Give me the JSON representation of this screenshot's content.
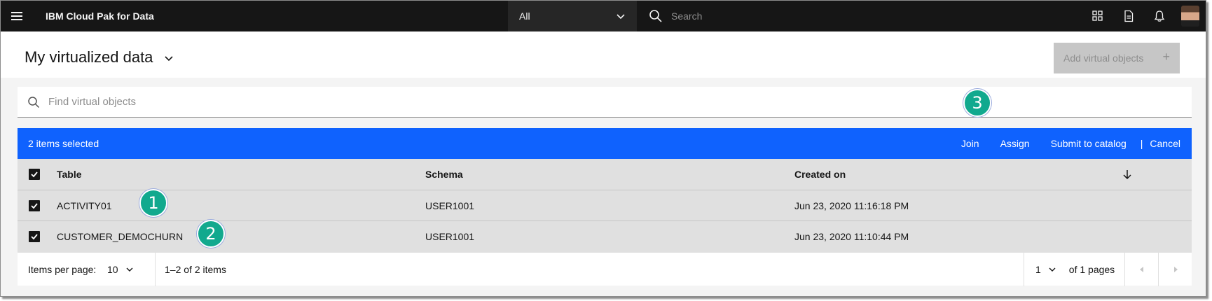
{
  "header": {
    "brand": "IBM Cloud Pak for Data",
    "scope_label": "All",
    "search_placeholder": "Search"
  },
  "page": {
    "title": "My virtualized data",
    "add_button_label": "Add virtual objects",
    "add_button_icon": "+"
  },
  "find": {
    "placeholder": "Find virtual objects"
  },
  "selection_bar": {
    "count_label": "2 items selected",
    "actions": [
      "Join",
      "Assign",
      "Submit to catalog"
    ],
    "separator": "|",
    "cancel_label": "Cancel",
    "color": "#0f62fe"
  },
  "table": {
    "headers": {
      "table": "Table",
      "schema": "Schema",
      "created_on": "Created on"
    },
    "rows": [
      {
        "table": "ACTIVITY01",
        "schema": "USER1001",
        "created_on": "Jun 23, 2020 11:16:18 PM",
        "selected": true
      },
      {
        "table": "CUSTOMER_DEMOCHURN",
        "schema": "USER1001",
        "created_on": "Jun 23, 2020 11:10:44 PM",
        "selected": true
      }
    ]
  },
  "pagination": {
    "items_per_page_label": "Items per page:",
    "items_per_page_value": "10",
    "range_label": "1–2 of 2 items",
    "current_page": "1",
    "of_pages_label": "of 1 pages"
  },
  "callouts": [
    "1",
    "2",
    "3"
  ],
  "colors": {
    "header_bg": "#161616",
    "callout": "#11a98e",
    "disabled_button": "#c6c6c6"
  },
  "icons": [
    "menu-icon",
    "chevron-down-icon",
    "search-icon",
    "apps-icon",
    "document-icon",
    "notification-icon",
    "avatar",
    "add-icon",
    "checkbox-checked-icon",
    "arrow-down-icon",
    "caret-left-icon",
    "caret-right-icon"
  ]
}
